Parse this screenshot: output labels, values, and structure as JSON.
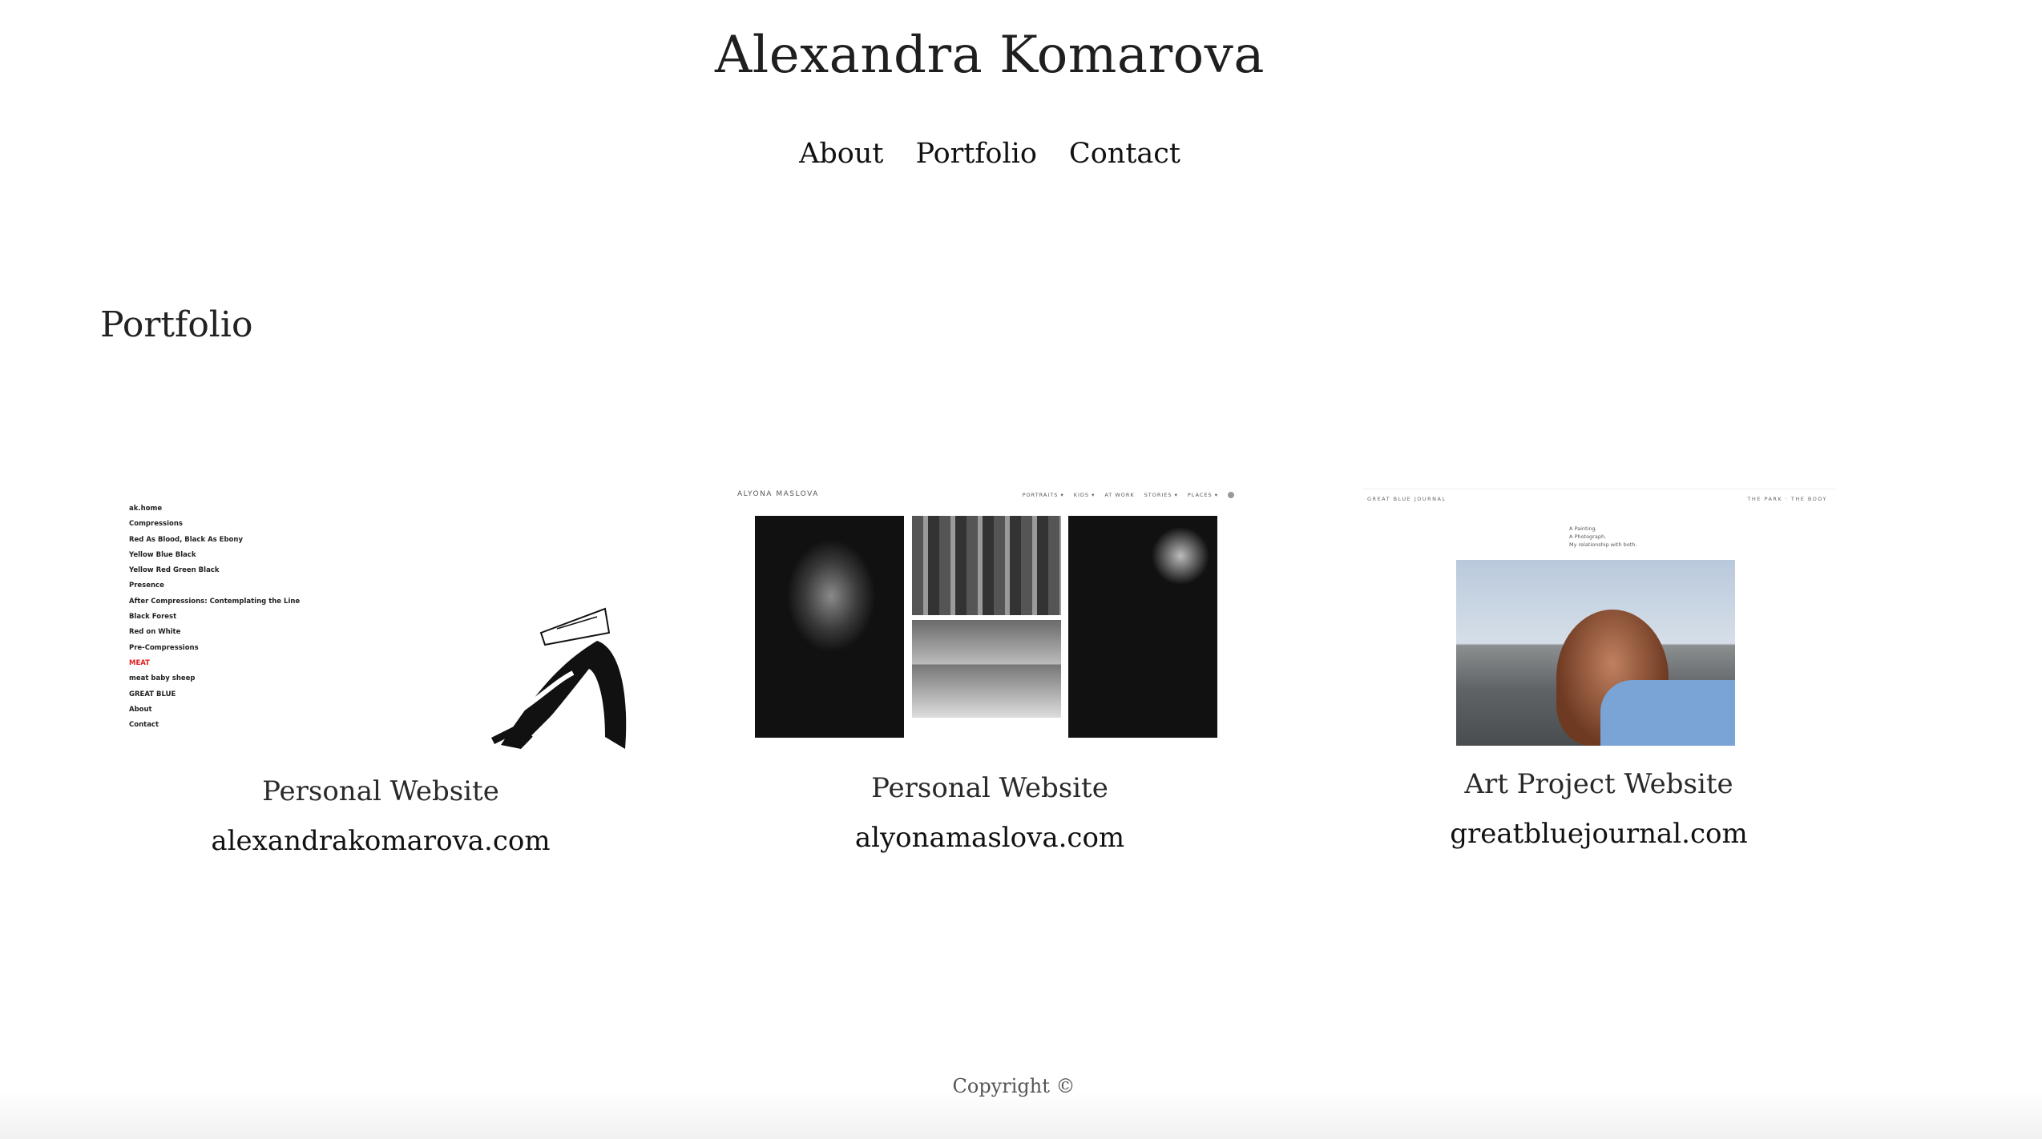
{
  "site": {
    "title": "Alexandra Komarova"
  },
  "nav": [
    {
      "label": "About"
    },
    {
      "label": "Portfolio"
    },
    {
      "label": "Contact"
    }
  ],
  "portfolio": {
    "title": "Portfolio",
    "cards": [
      {
        "kind": "Personal Website",
        "url": "alexandrakomarova.com",
        "thumb_menu": [
          "ak.home",
          "Compressions",
          "Red As Blood, Black As Ebony",
          "Yellow Blue Black",
          "Yellow Red Green Black",
          "Presence",
          "After Compressions: Contemplating the Line",
          "Black Forest",
          "Red on White",
          "Pre-Compressions",
          "MEAT",
          "meat baby sheep",
          "GREAT BLUE",
          "About",
          "Contact"
        ],
        "thumb_menu_active": "MEAT"
      },
      {
        "kind": "Personal Website",
        "url": "alyonamaslova.com",
        "thumb_brand": "ALYONA MASLOVA",
        "thumb_menu": [
          "PORTRAITS ▾",
          "KIDS ▾",
          "AT WORK",
          "STORIES ▾",
          "PLACES ▾"
        ]
      },
      {
        "kind": "Art Project Website",
        "url": "greatbluejournal.com",
        "thumb_brand": "GREAT BLUE JOURNAL",
        "thumb_links": "THE PARK · THE BODY",
        "thumb_lines": [
          "A Painting.",
          "A Photograph.",
          "My relationship with both."
        ]
      }
    ]
  },
  "footer": {
    "text": "Copyright ©"
  },
  "colors": {
    "text": "#1c1c1c",
    "accent_red": "#e02020",
    "background": "#ffffff"
  }
}
